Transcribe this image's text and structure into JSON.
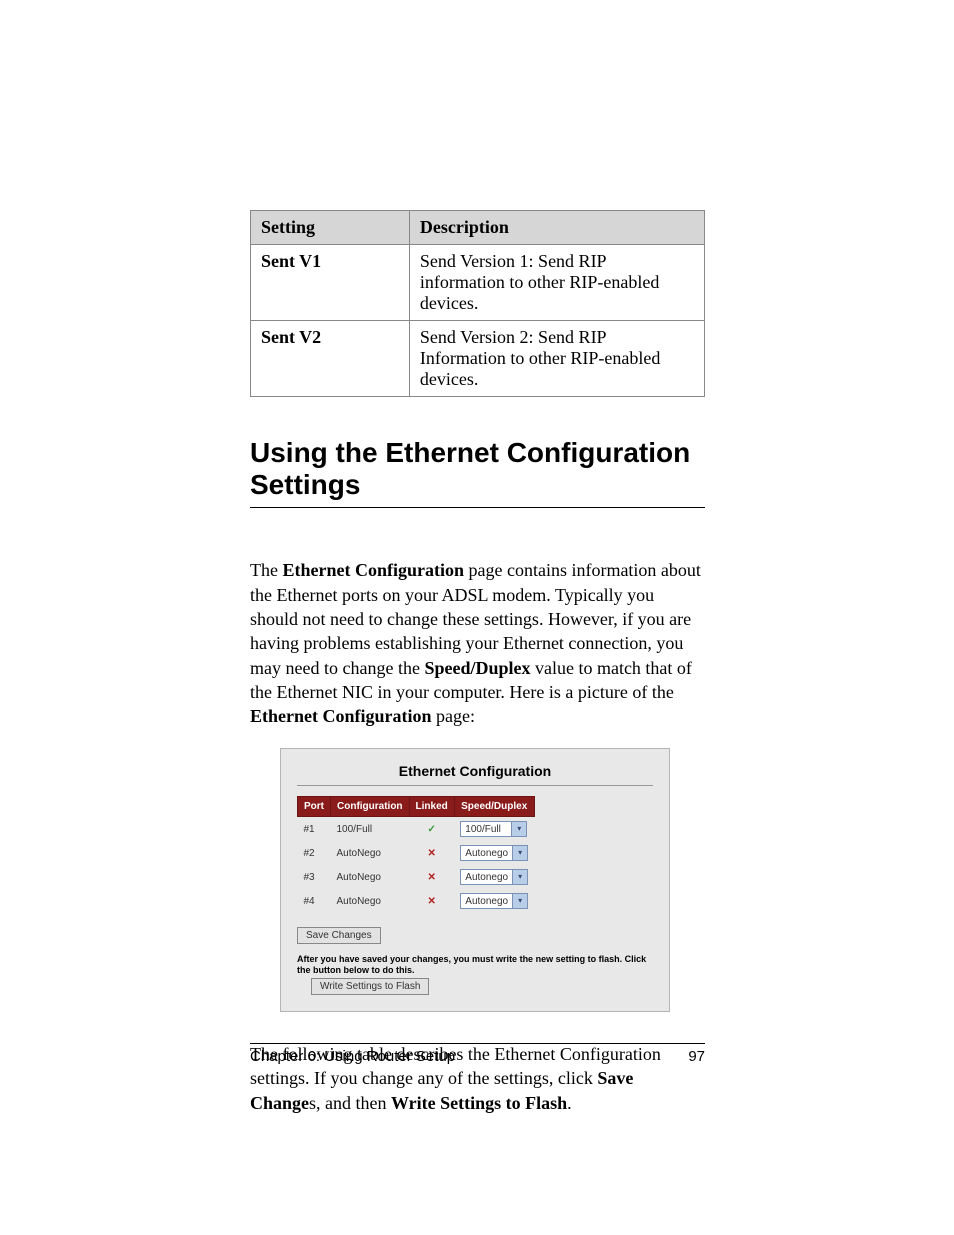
{
  "settingsTable": {
    "headers": {
      "setting": "Setting",
      "description": "Description"
    },
    "rows": [
      {
        "setting": "Sent V1",
        "description": "Send Version 1: Send RIP information to other RIP-enabled devices."
      },
      {
        "setting": "Sent V2",
        "description": "Send Version 2: Send RIP Information to other RIP-enabled devices."
      }
    ]
  },
  "heading": "Using the Ethernet Configuration Settings",
  "para1": {
    "t1": "The ",
    "b1": "Ethernet Configuration",
    "t2": " page contains information about the Ethernet ports on your ADSL modem. Typically you should not need to change these settings. However, if you are having problems establishing your Ethernet connection, you may need to change the ",
    "b2": "Speed/Duplex",
    "t3": " value to match that of the Ethernet NIC in your computer. Here is a picture of the ",
    "b3": "Ethernet Configuration",
    "t4": " page:"
  },
  "shot": {
    "title": "Ethernet Configuration",
    "headers": {
      "port": "Port",
      "config": "Configuration",
      "linked": "Linked",
      "speed": "Speed/Duplex"
    },
    "rows": [
      {
        "port": "#1",
        "config": "100/Full",
        "linked": "check",
        "speed": "100/Full"
      },
      {
        "port": "#2",
        "config": "AutoNego",
        "linked": "cross",
        "speed": "Autonego"
      },
      {
        "port": "#3",
        "config": "AutoNego",
        "linked": "cross",
        "speed": "Autonego"
      },
      {
        "port": "#4",
        "config": "AutoNego",
        "linked": "cross",
        "speed": "Autonego"
      }
    ],
    "saveBtn": "Save Changes",
    "note": "After you have saved your changes, you must write the new setting to flash. Click the button below to do this.",
    "writeBtn": "Write Settings to Flash"
  },
  "para2": {
    "t1": "The following table describes the Ethernet Configuration settings. If you change any of the settings, click ",
    "b1": "Save Change",
    "t2": "s, and then ",
    "b2": "Write Settings to Flash",
    "t3": "."
  },
  "footer": {
    "chapter": "Chapter 6: Using Router Setup",
    "page": "97"
  }
}
